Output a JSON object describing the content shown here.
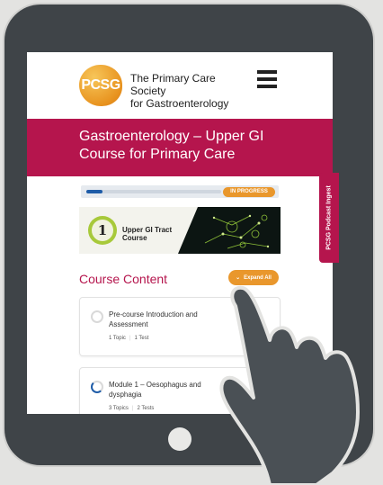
{
  "header": {
    "logo_text": "PCSG",
    "org_name_line1": "The Primary Care Society",
    "org_name_line2": "for Gastroenterology"
  },
  "banner": {
    "title": "Gastroenterology – Upper GI Course for Primary Care"
  },
  "progress": {
    "status": "IN PROGRESS",
    "percent": 12
  },
  "course_image": {
    "number": "1",
    "label": "Upper GI Tract Course"
  },
  "course_content": {
    "title": "Course Content",
    "expand_label": "Expand All"
  },
  "modules": [
    {
      "title": "Pre-course Introduction and Assessment",
      "topics": "1 Topic",
      "tests": "1 Test"
    },
    {
      "title": "Module 1 – Oesophagus and dysphagia",
      "topics": "3 Topics",
      "tests": "2 Tests"
    }
  ],
  "side_tab": {
    "label": "PCSG Podcast Ingest"
  },
  "colors": {
    "brand": "#b5154d",
    "accent": "#e9972c",
    "progress": "#1e5ca8"
  }
}
